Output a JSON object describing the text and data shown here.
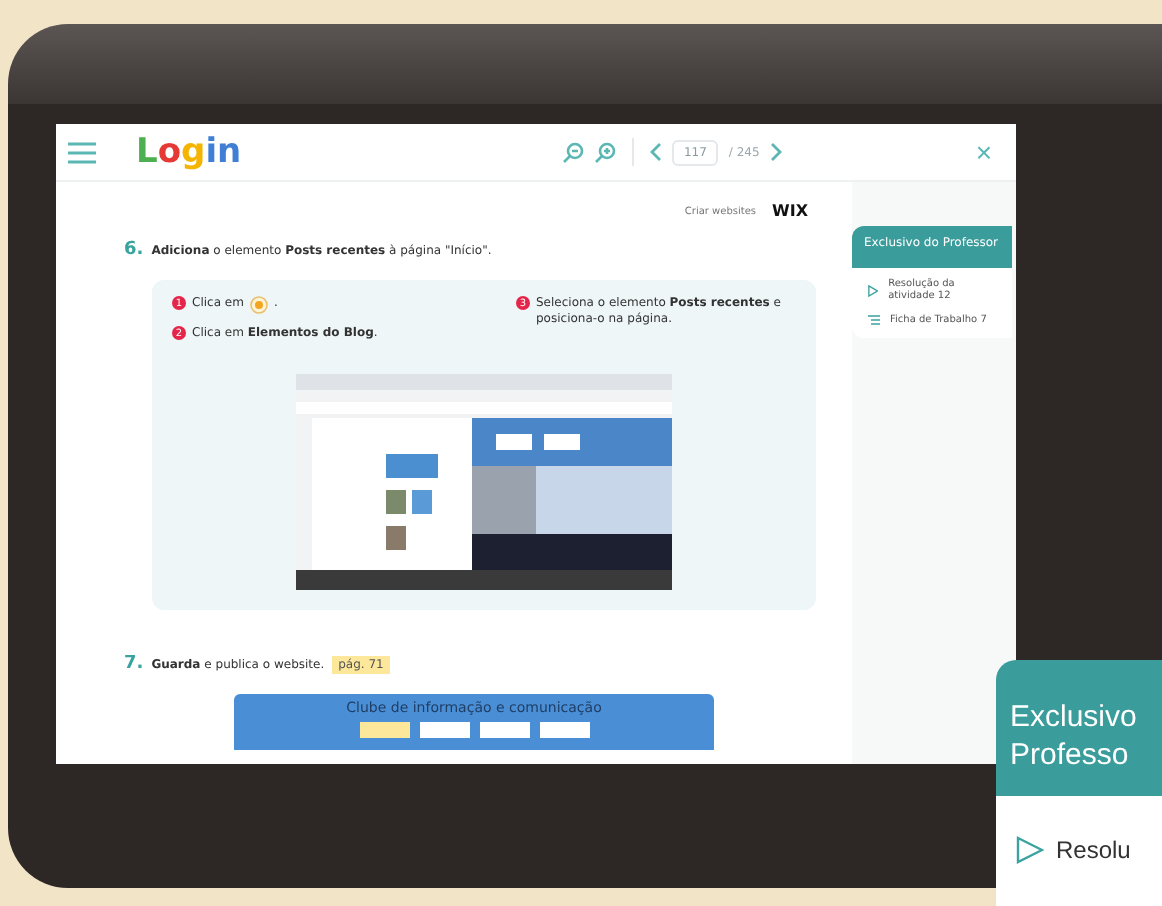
{
  "toolbar": {
    "logo": "Login",
    "page": "117",
    "total": "/ 245",
    "close": "×"
  },
  "brand": {
    "label": "Criar websites",
    "logo": "WIX"
  },
  "step6": {
    "number": "6.",
    "text": "**Adiciona** o elemento **Posts recentes** à página \"Início\".",
    "substeps": [
      {
        "number": "1",
        "text": "Clica em",
        "suffix": "."
      },
      {
        "number": "2",
        "text": "Clica em **Elementos do Blog**."
      },
      {
        "number": "3",
        "text": "Seleciona o elemento **Posts recentes** e posiciona-o na página."
      }
    ]
  },
  "step7": {
    "number": "7.",
    "text": "**Guarda** e publica o website.",
    "tag": "pág. 71",
    "banner": "Clube de informação e comunicação"
  },
  "side_panel": {
    "title": "Exclusivo do Professor",
    "items": [
      {
        "kind": "video",
        "label": "Resolução da atividade 12"
      },
      {
        "kind": "list",
        "label": "Ficha de Trabalho 7"
      }
    ]
  },
  "zoom_card": {
    "title_lines": [
      "Exclusivo",
      "Professo"
    ],
    "item": "Resolu"
  }
}
